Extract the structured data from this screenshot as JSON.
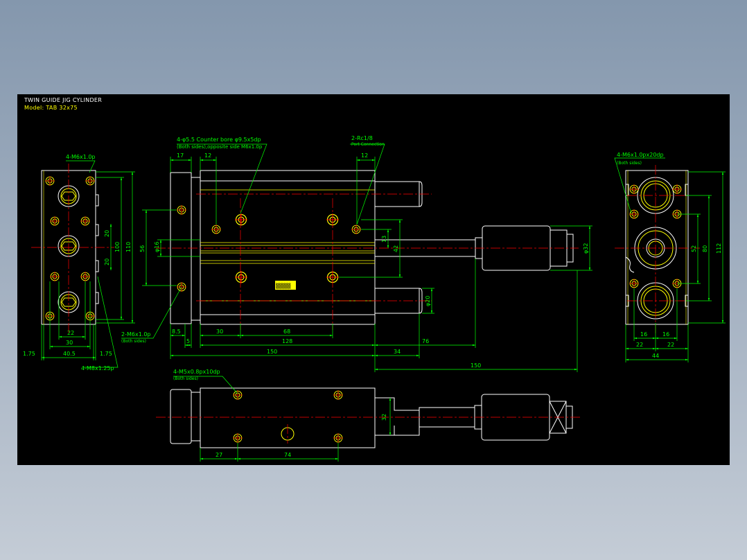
{
  "title_block": {
    "title": "TWIN GUIDE JIG CYLINDER",
    "model": "Model: TAB 32x75"
  },
  "colors": {
    "background": "#000000",
    "outline": "#ffffff",
    "yellow": "#ffff00",
    "dimension": "#00ff00",
    "centerline": "#ff0000"
  },
  "annotations": {
    "left_top_thread": "4-M6x1.0p",
    "left_bottom_thread": "4-M8x1.25p",
    "counterbore_1": "4-φ5.5  Counter bore φ9.5x5dp",
    "counterbore_2": "(Both sides),opposite side M6x1.0p",
    "port_1": "2-Rc1/8",
    "port_2": "Port Connection",
    "side_thread_1": "2-M6x1.0p",
    "side_thread_2": "(Both sides)",
    "right_thread_1": "4-M6x1.0px20dp",
    "right_thread_2": "(Both sides)",
    "bottom_thread_1": "4-M5x0.8px10dp",
    "bottom_thread_2": "(Both sides)",
    "nameplate": "▒▒▒▒"
  },
  "dims": {
    "d_1_75_left": "1.75",
    "d_1_75_right": "1.75",
    "d_40_5": "40.5",
    "d_30_left": "30",
    "d_22_left": "22",
    "d_20_a": "20",
    "d_20_b": "20",
    "d_100": "100",
    "d_110": "110",
    "d_17": "17",
    "d_12_a": "12",
    "d_12_b": "12",
    "d_56": "56",
    "d_phi16": "φ16",
    "d_13": "13",
    "d_42": "42",
    "d_phi32": "φ32",
    "d_phi20": "φ20",
    "d_8_5": "8.5",
    "d_5": "5",
    "d_30_mid": "30",
    "d_68": "68",
    "d_128": "128",
    "d_76": "76",
    "d_150_a": "150",
    "d_34": "34",
    "d_150_b": "150",
    "d_16_a": "16",
    "d_16_b": "16",
    "d_22_a": "22",
    "d_22_b": "22",
    "d_44": "44",
    "d_52": "52",
    "d_80": "80",
    "d_112": "112",
    "d_32_bottom": "32",
    "d_27": "27",
    "d_74": "74"
  }
}
